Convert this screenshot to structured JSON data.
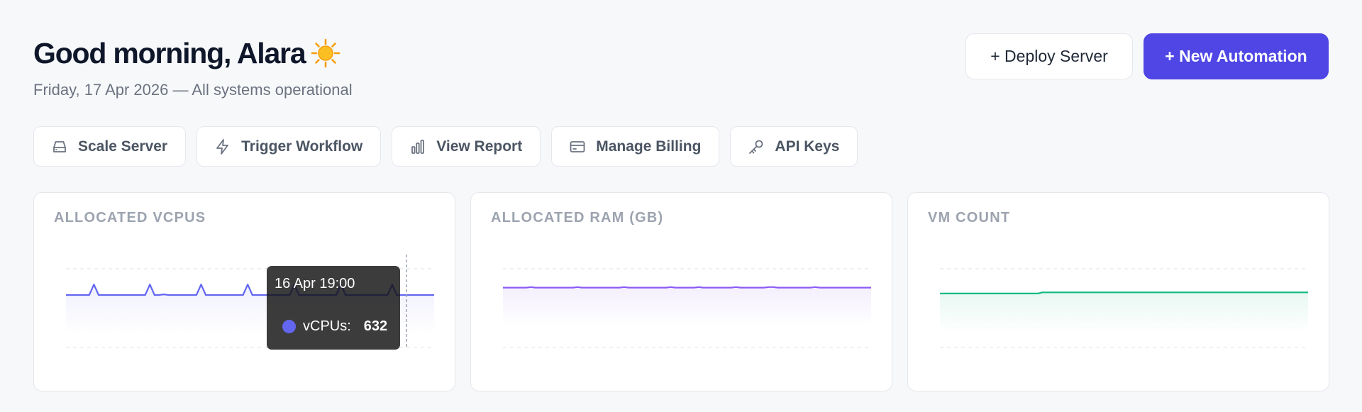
{
  "header": {
    "greeting": "Good morning, Alara",
    "subtitle": "Friday, 17 Apr 2026 — All systems operational"
  },
  "actions": {
    "deploy_label": "+ Deploy Server",
    "new_automation_label": "+ New Automation"
  },
  "quick_actions": [
    {
      "label": "Scale Server",
      "icon": "server-icon"
    },
    {
      "label": "Trigger Workflow",
      "icon": "lightning-icon"
    },
    {
      "label": "View Report",
      "icon": "bar-chart-icon"
    },
    {
      "label": "Manage Billing",
      "icon": "credit-card-icon"
    },
    {
      "label": "API Keys",
      "icon": "key-icon"
    }
  ],
  "colors": {
    "accent": "#4f46e5",
    "vcpu_line": "#6366f1",
    "ram_line": "#8b5cf6",
    "vm_line": "#10b981"
  },
  "cards": [
    {
      "title": "ALLOCATED VCPUS"
    },
    {
      "title": "ALLOCATED RAM (GB)"
    },
    {
      "title": "VM COUNT"
    }
  ],
  "tooltip": {
    "time": "16 Apr 19:00",
    "series": "vCPUs:",
    "value": "632"
  },
  "chart_data": [
    {
      "type": "line",
      "title": "ALLOCATED VCPUS",
      "series": [
        {
          "name": "vCPUs",
          "values": [
            600,
            600,
            600,
            600,
            600,
            600,
            632,
            600,
            600,
            600,
            600,
            600,
            600,
            600,
            600,
            600,
            600,
            600,
            632,
            600,
            600,
            602,
            600,
            600,
            600,
            600,
            600,
            600,
            600,
            632,
            600,
            600,
            600,
            600,
            600,
            600,
            600,
            600,
            600,
            632,
            600,
            600,
            600,
            600,
            600,
            600,
            600,
            600,
            600,
            632,
            600,
            600,
            600,
            600,
            600,
            600,
            600,
            600,
            600,
            632,
            600,
            600,
            600,
            600,
            600,
            600,
            600,
            600,
            600,
            600,
            632,
            600,
            600,
            600,
            600,
            600,
            600,
            600,
            600,
            600
          ]
        }
      ],
      "ylim": [
        440,
        680
      ]
    },
    {
      "type": "area",
      "title": "ALLOCATED RAM (GB)",
      "series": [
        {
          "values": [
            1180,
            1180,
            1180,
            1180,
            1180,
            1180,
            1184,
            1180,
            1180,
            1180,
            1180,
            1180,
            1180,
            1180,
            1180,
            1180,
            1184,
            1180,
            1180,
            1180,
            1180,
            1180,
            1180,
            1180,
            1180,
            1180,
            1184,
            1180,
            1180,
            1180,
            1180,
            1180,
            1180,
            1180,
            1180,
            1180,
            1184,
            1180,
            1180,
            1180,
            1180,
            1180,
            1184,
            1180,
            1180,
            1180,
            1180,
            1180,
            1180,
            1180,
            1184,
            1180,
            1180,
            1180,
            1180,
            1180,
            1180,
            1184,
            1184,
            1180,
            1180,
            1180,
            1180,
            1180,
            1180,
            1180,
            1180,
            1184,
            1180,
            1180,
            1180,
            1180,
            1180,
            1180,
            1180,
            1180,
            1180,
            1180,
            1180,
            1180
          ]
        }
      ],
      "ylim": [
        800,
        1300
      ]
    },
    {
      "type": "area",
      "title": "VM COUNT",
      "series": [
        {
          "values": [
            48,
            48,
            48,
            48,
            48,
            48,
            48,
            48,
            48,
            48,
            48,
            48,
            48,
            48,
            48,
            48,
            48,
            48,
            48,
            48,
            48,
            48,
            49,
            49,
            49,
            49,
            49,
            49,
            49,
            49,
            49,
            49,
            49,
            49,
            49,
            49,
            49,
            49,
            49,
            49,
            49,
            49,
            49,
            49,
            49,
            49,
            49,
            49,
            49,
            49,
            49,
            49,
            49,
            49,
            49,
            49,
            49,
            49,
            49,
            49,
            49,
            49,
            49,
            49,
            49,
            49,
            49,
            49,
            49,
            49,
            49,
            49,
            49,
            49,
            49,
            49,
            49,
            49,
            49,
            49
          ]
        }
      ],
      "ylim": [
        0,
        70
      ]
    }
  ]
}
